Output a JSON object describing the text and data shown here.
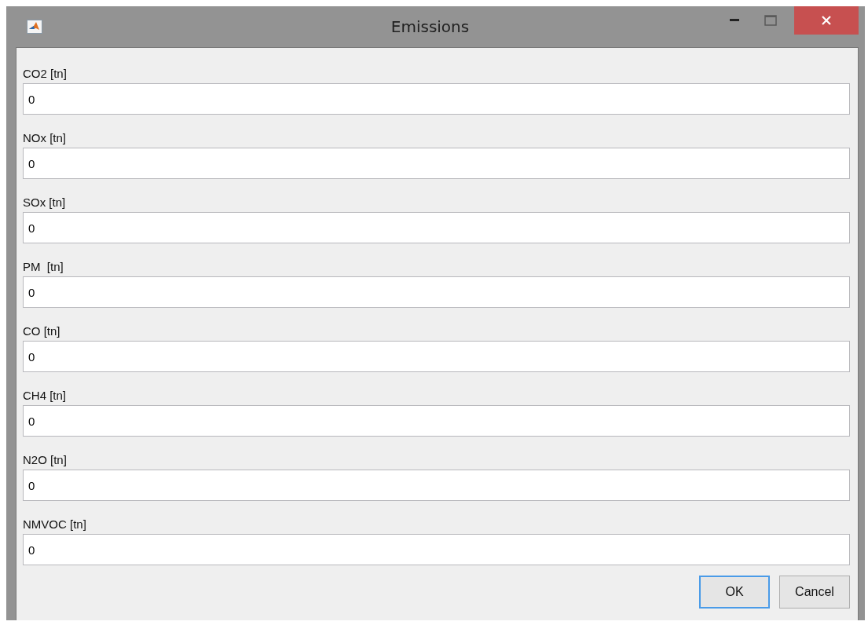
{
  "window": {
    "title": "Emissions"
  },
  "fields": [
    {
      "label": "CO2 [tn]",
      "value": "0"
    },
    {
      "label": "NOx [tn]",
      "value": "0"
    },
    {
      "label": "SOx [tn]",
      "value": "0"
    },
    {
      "label": "PM  [tn]",
      "value": "0"
    },
    {
      "label": "CO [tn]",
      "value": "0"
    },
    {
      "label": "CH4 [tn]",
      "value": "0"
    },
    {
      "label": "N2O [tn]",
      "value": "0"
    },
    {
      "label": "NMVOC [tn]",
      "value": "0"
    }
  ],
  "buttons": [
    {
      "label": "OK",
      "focused": true
    },
    {
      "label": "Cancel",
      "focused": false
    }
  ]
}
